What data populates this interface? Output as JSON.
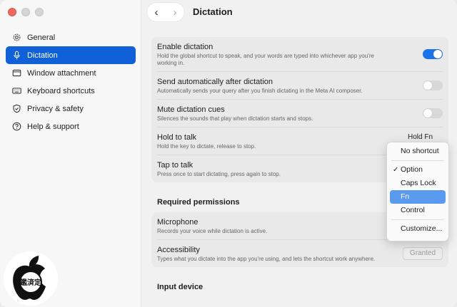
{
  "sidebar": {
    "items": [
      {
        "label": "General",
        "icon": "gear-icon"
      },
      {
        "label": "Dictation",
        "icon": "microphone-icon",
        "active": true
      },
      {
        "label": "Window attachment",
        "icon": "window-icon"
      },
      {
        "label": "Keyboard shortcuts",
        "icon": "keyboard-icon"
      },
      {
        "label": "Privacy & safety",
        "icon": "shield-icon"
      },
      {
        "label": "Help & support",
        "icon": "question-icon"
      }
    ]
  },
  "header": {
    "title": "Dictation",
    "back": "‹",
    "forward": "›"
  },
  "dictation": {
    "enable": {
      "label": "Enable dictation",
      "desc": "Hold the global shortcut to speak, and your words are typed into whichever app you're working in.",
      "on": true
    },
    "send_auto": {
      "label": "Send automatically after dictation",
      "desc": "Automatically sends your query after you finish dictating in the Meta AI composer.",
      "on": false
    },
    "mute": {
      "label": "Mute dictation cues",
      "desc": "Silences the sounds that play when dictation starts and stops.",
      "on": false
    },
    "hold": {
      "label": "Hold to talk",
      "desc": "Hold the key to dictate, release to stop.",
      "value": "Hold Fn"
    },
    "tap": {
      "label": "Tap to talk",
      "desc": "Press once to start dictating, press again to stop."
    }
  },
  "permissions": {
    "heading": "Required permissions",
    "microphone": {
      "label": "Microphone",
      "desc": "Records your voice while dictation is active."
    },
    "accessibility": {
      "label": "Accessibility",
      "desc": "Types what you dictate into the app you're using, and lets the shortcut work anywhere.",
      "button": "Granted"
    }
  },
  "input_device": {
    "heading": "Input device"
  },
  "menu": {
    "items": [
      "No shortcut",
      "Option",
      "Caps Lock",
      "Fn",
      "Control",
      "Customize..."
    ],
    "checked": "Option",
    "highlighted": "Fn"
  },
  "seal": {
    "text": "鑑済定"
  },
  "colors": {
    "accent": "#1060d8",
    "toggle_on": "#1a73e8",
    "menu_highlight": "#5b9bef"
  }
}
